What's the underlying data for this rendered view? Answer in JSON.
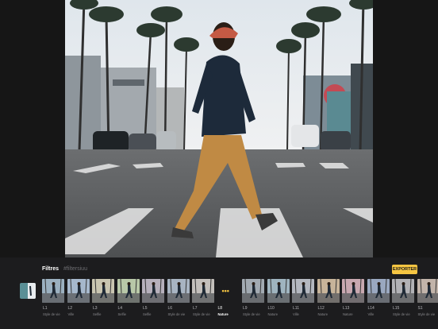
{
  "panel": {
    "title": "Filtres",
    "tag": "#filtersiuu",
    "export_label": "EXPORTER",
    "more_label": "•••",
    "colors": {
      "accent": "#f5c542",
      "panel_bg": "#1c1c1e",
      "background": "#111111"
    }
  },
  "filters": [
    {
      "code": "L1",
      "name": "Style de vie",
      "tint": "#9bb0c0"
    },
    {
      "code": "L2",
      "name": "Ville",
      "tint": "#a6b8cc"
    },
    {
      "code": "L3",
      "name": "Selfie",
      "tint": "#c9c5b0"
    },
    {
      "code": "L4",
      "name": "Selfie",
      "tint": "#b8c8a8"
    },
    {
      "code": "L5",
      "name": "Selfie",
      "tint": "#b6b0bc"
    },
    {
      "code": "L6",
      "name": "Style de vie",
      "tint": "#a8b4c2"
    },
    {
      "code": "L7",
      "name": "Style de vie",
      "tint": "#c4c0bc"
    },
    {
      "code": "L8",
      "name": "Nature",
      "tint": "#1c1c1e",
      "selected": true
    },
    {
      "code": "L9",
      "name": "Style de vie",
      "tint": "#a2aab2"
    },
    {
      "code": "L10",
      "name": "Nature",
      "tint": "#9fb4bf"
    },
    {
      "code": "L11",
      "name": "Ville",
      "tint": "#b4b8c0"
    },
    {
      "code": "L12",
      "name": "Nature",
      "tint": "#c7b49a"
    },
    {
      "code": "L13",
      "name": "Nature",
      "tint": "#c8a8b0"
    },
    {
      "code": "L14",
      "name": "Ville",
      "tint": "#9aa8c0"
    },
    {
      "code": "L15",
      "name": "Style de vie",
      "tint": "#b2b2b6"
    },
    {
      "code": "S1",
      "name": "Style de vie",
      "tint": "#c2b4aa"
    }
  ]
}
